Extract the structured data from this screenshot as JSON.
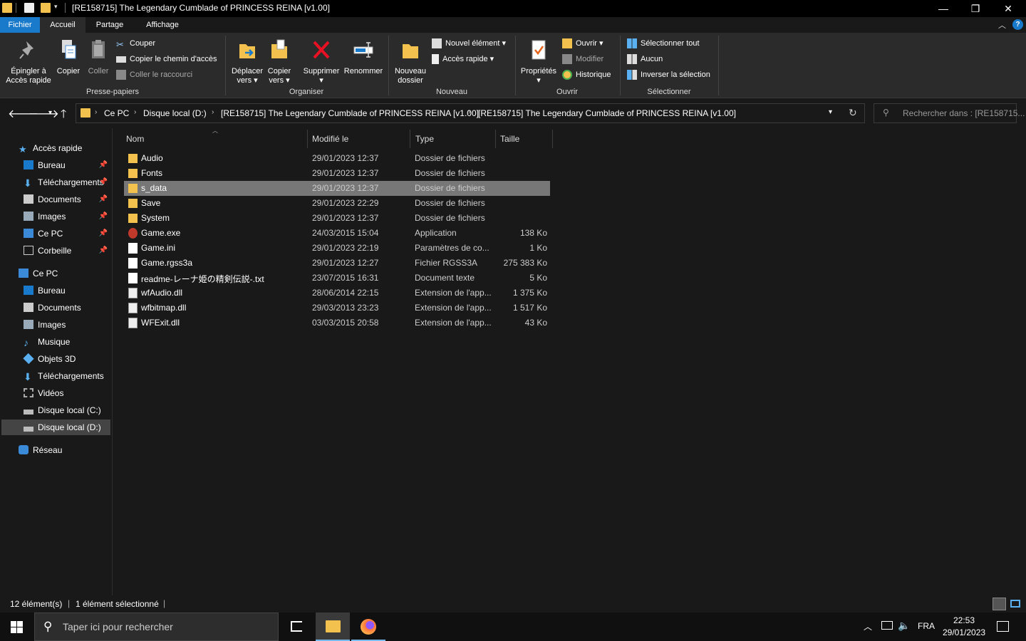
{
  "window": {
    "title": "[RE158715] The Legendary Cumblade of PRINCESS REINA [v1.00]",
    "minimize": "—",
    "maximize": "❐",
    "close": "✕"
  },
  "ribbon_tabs": [
    "Fichier",
    "Accueil",
    "Partage",
    "Affichage"
  ],
  "ribbon": {
    "pin_label_1": "Épingler à",
    "pin_label_2": "Accès rapide",
    "copy": "Copier",
    "paste": "Coller",
    "cut": "Couper",
    "copy_path": "Copier le chemin d'accès",
    "paste_shortcut": "Coller le raccourci",
    "group_clipboard": "Presse-papiers",
    "move_1": "Déplacer",
    "move_2": "vers",
    "copyto_1": "Copier",
    "copyto_2": "vers",
    "delete": "Supprimer",
    "rename": "Renommer",
    "group_organize": "Organiser",
    "newfolder_1": "Nouveau",
    "newfolder_2": "dossier",
    "new_item": "Nouvel élément",
    "quick_access": "Accès rapide",
    "group_new": "Nouveau",
    "properties": "Propriétés",
    "open": "Ouvrir",
    "modify": "Modifier",
    "history": "Historique",
    "group_open": "Ouvrir",
    "select_all": "Sélectionner tout",
    "select_none": "Aucun",
    "invert_selection": "Inverser la sélection",
    "group_select": "Sélectionner"
  },
  "address": {
    "crumbs": [
      "Ce PC",
      "Disque local (D:)",
      "[RE158715] The Legendary Cumblade of PRINCESS REINA [v1.00]",
      "[RE158715] The Legendary Cumblade of PRINCESS REINA [v1.00]"
    ],
    "search_placeholder": "Rechercher dans : [RE158715..."
  },
  "sidebar": {
    "quick_access": "Accès rapide",
    "quick_items": [
      "Bureau",
      "Téléchargements",
      "Documents",
      "Images",
      "Ce PC",
      "Corbeille"
    ],
    "this_pc": "Ce PC",
    "pc_items": [
      "Bureau",
      "Documents",
      "Images",
      "Musique",
      "Objets 3D",
      "Téléchargements",
      "Vidéos",
      "Disque local (C:)",
      "Disque local (D:)"
    ],
    "network": "Réseau"
  },
  "columns": {
    "name": "Nom",
    "modified": "Modifié le",
    "type": "Type",
    "size": "Taille"
  },
  "files": [
    {
      "name": "Audio",
      "date": "29/01/2023 12:37",
      "type": "Dossier de fichiers",
      "size": ""
    },
    {
      "name": "Fonts",
      "date": "29/01/2023 12:37",
      "type": "Dossier de fichiers",
      "size": ""
    },
    {
      "name": "s_data",
      "date": "29/01/2023 12:37",
      "type": "Dossier de fichiers",
      "size": ""
    },
    {
      "name": "Save",
      "date": "29/01/2023 22:29",
      "type": "Dossier de fichiers",
      "size": ""
    },
    {
      "name": "System",
      "date": "29/01/2023 12:37",
      "type": "Dossier de fichiers",
      "size": ""
    },
    {
      "name": "Game.exe",
      "date": "24/03/2015 15:04",
      "type": "Application",
      "size": "138 Ko"
    },
    {
      "name": "Game.ini",
      "date": "29/01/2023 22:19",
      "type": "Paramètres de co...",
      "size": "1 Ko"
    },
    {
      "name": "Game.rgss3a",
      "date": "29/01/2023 12:27",
      "type": "Fichier RGSS3A",
      "size": "275 383 Ko"
    },
    {
      "name": "readme-レーナ姫の精剣伝説-.txt",
      "date": "23/07/2015 16:31",
      "type": "Document texte",
      "size": "5 Ko"
    },
    {
      "name": "wfAudio.dll",
      "date": "28/06/2014 22:15",
      "type": "Extension de l'app...",
      "size": "1 375 Ko"
    },
    {
      "name": "wfbitmap.dll",
      "date": "29/03/2013 23:23",
      "type": "Extension de l'app...",
      "size": "1 517 Ko"
    },
    {
      "name": "WFExit.dll",
      "date": "03/03/2015 20:58",
      "type": "Extension de l'app...",
      "size": "43 Ko"
    }
  ],
  "status": {
    "count": "12 élément(s)",
    "selected": "1 élément sélectionné"
  },
  "taskbar": {
    "search_placeholder": "Taper ici pour rechercher",
    "lang": "FRA",
    "time": "22:53",
    "date": "29/01/2023"
  }
}
